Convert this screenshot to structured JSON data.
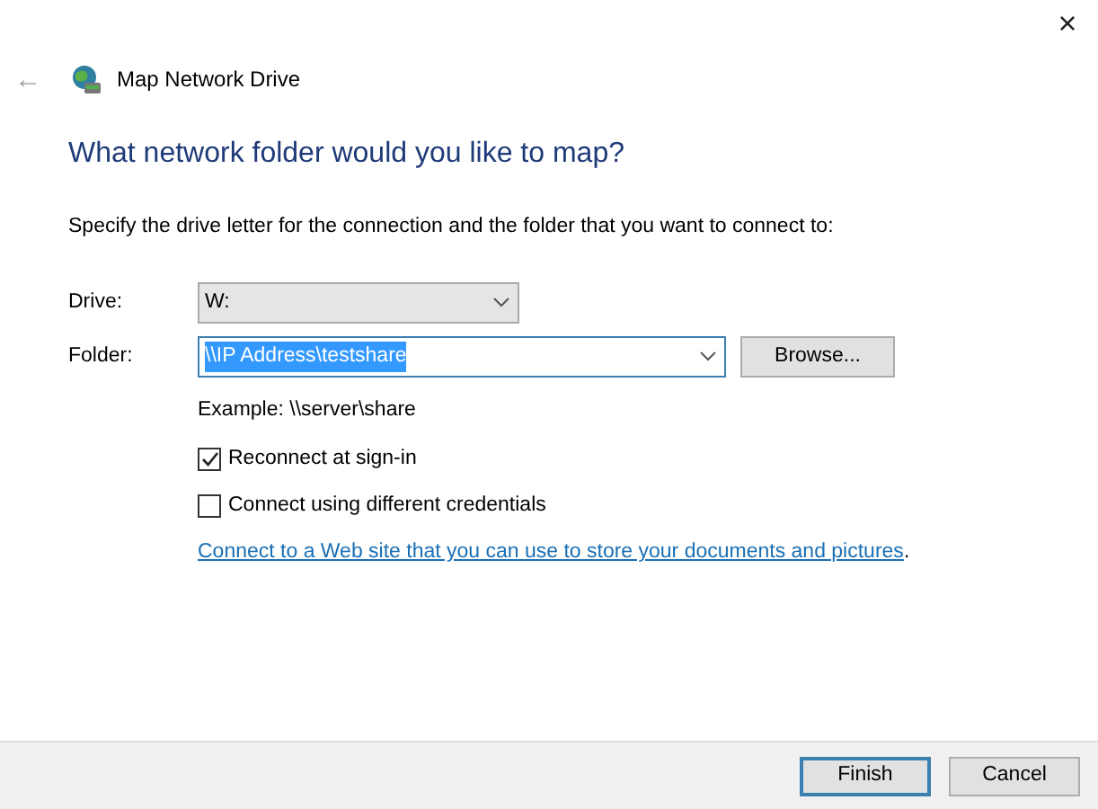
{
  "window": {
    "title": "Map Network Drive",
    "close": "×",
    "back": "←"
  },
  "heading": "What network folder would you like to map?",
  "instruction": "Specify the drive letter for the connection and the folder that you want to connect to:",
  "fields": [
    {
      "label": "Drive:",
      "value": "W:",
      "kind": "dropdown",
      "focused": false,
      "value_selected": false
    },
    {
      "label": "Folder:",
      "value": "\\\\IP Address\\testshare",
      "kind": "combo",
      "focused": true,
      "value_selected": true,
      "button": "Browse..."
    }
  ],
  "example": "Example: \\\\server\\share",
  "checkboxes": [
    {
      "label": "Reconnect at sign-in",
      "checked": true
    },
    {
      "label": "Connect using different credentials",
      "checked": false
    }
  ],
  "link": {
    "text": "Connect to a Web site that you can use to store your documents and pictures",
    "suffix": "."
  },
  "buttons": [
    {
      "label": "Finish",
      "default": true
    },
    {
      "label": "Cancel",
      "default": false
    }
  ]
}
